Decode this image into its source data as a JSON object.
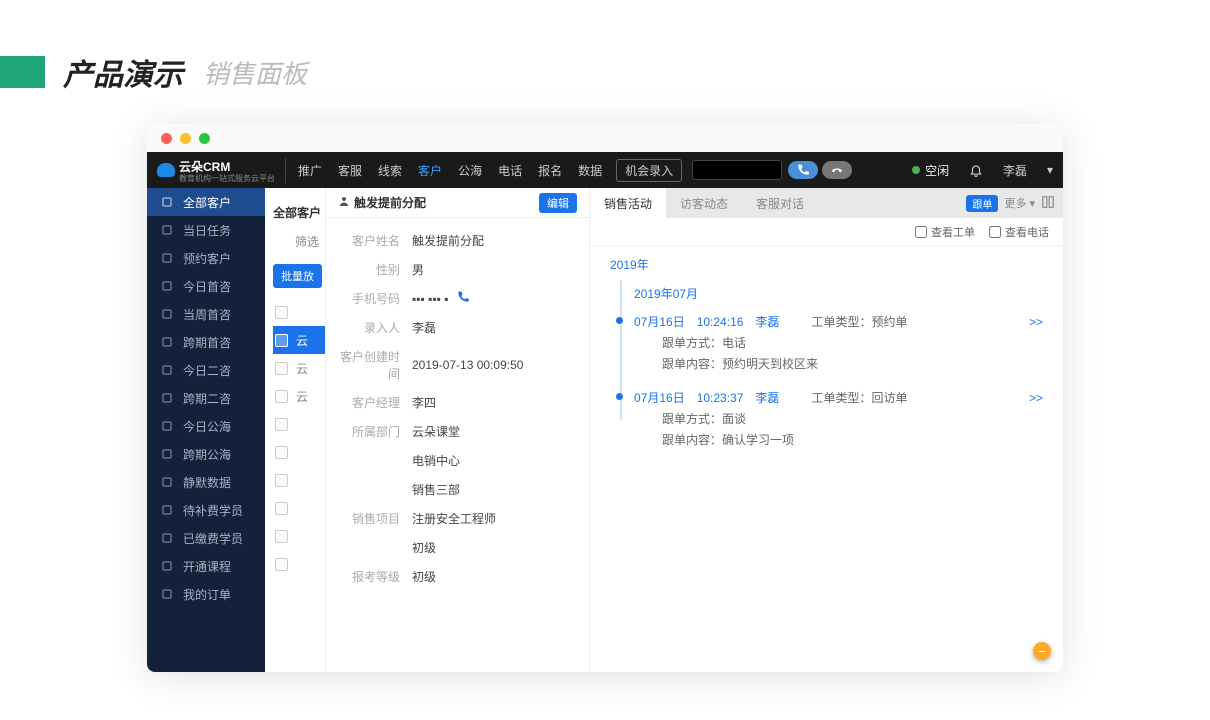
{
  "page_header": {
    "main": "产品演示",
    "sub": "销售面板"
  },
  "topbar": {
    "logo_text": "云朵CRM",
    "logo_sub": "教育机构一站式服务云平台",
    "nav": [
      "推广",
      "客服",
      "线索",
      "客户",
      "公海",
      "电话",
      "报名",
      "数据"
    ],
    "nav_active_index": 3,
    "opportunity_btn": "机会录入",
    "status": "空闲",
    "user": "李磊"
  },
  "sidebar": {
    "items": [
      "全部客户",
      "当日任务",
      "预约客户",
      "今日首咨",
      "当周首咨",
      "跨期首咨",
      "今日二咨",
      "跨期二咨",
      "今日公海",
      "跨期公海",
      "静默数据",
      "待补费学员",
      "已缴费学员",
      "开通课程",
      "我的订单"
    ],
    "active_index": 0
  },
  "list_partial": {
    "title": "全部客户",
    "filter_label": "筛选",
    "batch_label": "批量放",
    "rows": [
      "",
      "云",
      "云",
      "云",
      "",
      "",
      "",
      "",
      "",
      ""
    ],
    "highlight_index": 1
  },
  "detail": {
    "title": "触发提前分配",
    "edit_btn": "编辑",
    "fields": [
      {
        "label": "客户姓名",
        "value": "触发提前分配"
      },
      {
        "label": "性别",
        "value": "男"
      },
      {
        "label": "手机号码",
        "value": "▪▪▪ ▪▪▪ ▪",
        "phone": true
      },
      {
        "label": "录入人",
        "value": "李磊"
      },
      {
        "label": "客户创建时间",
        "value": "2019-07-13 00:09:50"
      },
      {
        "label": "客户经理",
        "value": "李四"
      },
      {
        "label": "所属部门",
        "value": "云朵课堂"
      },
      {
        "label": "",
        "value": "电销中心"
      },
      {
        "label": "",
        "value": "销售三部"
      },
      {
        "label": "销售项目",
        "value": "注册安全工程师"
      },
      {
        "label": "",
        "value": "初级"
      },
      {
        "label": "报考等级",
        "value": "初级"
      }
    ]
  },
  "activity": {
    "tabs": [
      "销售活动",
      "访客动态",
      "客服对话"
    ],
    "active_tab": 0,
    "followup_badge": "跟单",
    "more_label": "更多 ▾",
    "filter_ticket": "查看工单",
    "filter_phone": "查看电话",
    "year": "2019年",
    "month": "2019年07月",
    "items": [
      {
        "date": "07月16日",
        "time": "10:24:16",
        "user": "李磊",
        "type_label": "工单类型：",
        "type_value": "预约单",
        "method_label": "跟单方式：",
        "method_value": "电话",
        "content_label": "跟单内容：",
        "content_value": "预约明天到校区来"
      },
      {
        "date": "07月16日",
        "time": "10:23:37",
        "user": "李磊",
        "type_label": "工单类型：",
        "type_value": "回访单",
        "method_label": "跟单方式：",
        "method_value": "面谈",
        "content_label": "跟单内容：",
        "content_value": "确认学习一项"
      }
    ],
    "expand": ">>"
  }
}
